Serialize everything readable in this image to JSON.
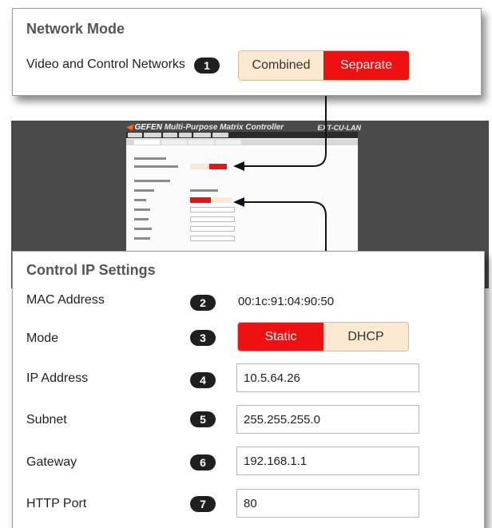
{
  "network_mode": {
    "title": "Network Mode",
    "row_label": "Video and Control Networks",
    "badge": "1",
    "options": [
      "Combined",
      "Separate"
    ],
    "selected": "Separate"
  },
  "background_app": {
    "brand": "GEFEN",
    "product": "Multi-Purpose Matrix Controller",
    "model": "EXT-CU-LAN"
  },
  "control_ip": {
    "title": "Control IP Settings",
    "rows": [
      {
        "label": "MAC Address",
        "badge": "2",
        "value": "00:1c:91:04:90:50"
      },
      {
        "label": "Mode",
        "badge": "3",
        "options": [
          "Static",
          "DHCP"
        ],
        "selected": "Static"
      },
      {
        "label": "IP Address",
        "badge": "4",
        "value": "10.5.64.26"
      },
      {
        "label": "Subnet",
        "badge": "5",
        "value": "255.255.255.0"
      },
      {
        "label": "Gateway",
        "badge": "6",
        "value": "192.168.1.1"
      },
      {
        "label": "HTTP Port",
        "badge": "7",
        "value": "80"
      }
    ]
  },
  "colors": {
    "selected": "#ee1111",
    "unselected": "#fde9d2",
    "badge": "#1f1f1f"
  }
}
